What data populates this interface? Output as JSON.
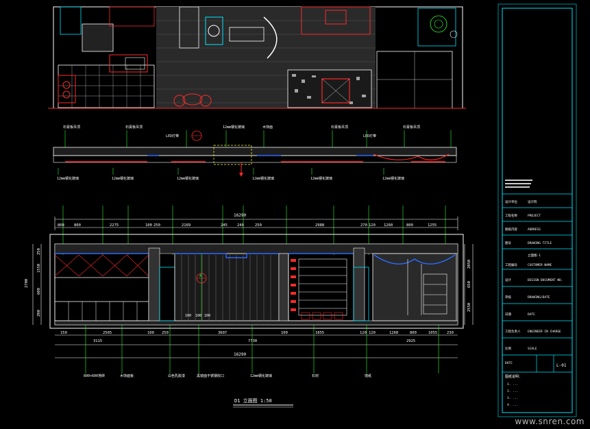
{
  "drawing": {
    "title_label": "D1  立面图  1:50",
    "watermark": "www.snren.com",
    "colors": {
      "background": "#000000",
      "line_white": "#ffffff",
      "line_cyan": "#00e5ff",
      "line_green": "#2bff2b",
      "line_red": "#ff2a2a",
      "line_blue": "#2a6bff",
      "line_yellow": "#ffff33",
      "line_magenta": "#ff33ff"
    },
    "section_labels": [
      "LED灯带",
      "12mm钢化玻璃",
      "木饰面",
      "石膏板吊顶",
      "LED灯带"
    ],
    "top_dimensions": [
      "808",
      "800",
      "2275",
      "100",
      "250",
      "2169",
      "245",
      "240",
      "250",
      "2988",
      "270",
      "120",
      "1260",
      "800",
      "1255"
    ],
    "total_top": "16290",
    "bottom_dimensions": [
      "150",
      "2565",
      "100",
      "250",
      "3607",
      "100",
      "1855",
      "120",
      "120",
      "1260",
      "800",
      "1055",
      "230"
    ],
    "bottom_totals": [
      "3115",
      "7730",
      "2925"
    ],
    "total_bottom": "16290",
    "height_dims_left": [
      "250",
      "1550",
      "600",
      "200"
    ],
    "height_dims_right": [
      "2050",
      "650",
      "2550"
    ],
    "height_total": "2700",
    "inner_dims": [
      "100",
      "100",
      "100"
    ],
    "bottom_notes": [
      "800×600地砖",
      "木饰面板",
      "白色乳胶漆",
      "黑镜面不锈钢收口",
      "12mm钢化玻璃",
      "石材",
      "墙纸"
    ],
    "center_mark": "A",
    "title_block": {
      "rows": [
        {
          "label": "设计单位",
          "value": "设计院"
        },
        {
          "label": "工程名称",
          "value": "PROJECT"
        },
        {
          "label": "图纸内容",
          "value": "ADDRESS"
        },
        {
          "label": "图号",
          "value": "DRAWING  TITLE"
        },
        {
          "label": "",
          "value": "立面图-1"
        },
        {
          "label": "工程编号",
          "value": "CUSTOMER NAME"
        },
        {
          "label": "设计",
          "value": "DESIGN DOCUMENT NO."
        },
        {
          "label": "审核",
          "value": "DRAWING/DATE"
        },
        {
          "label": "日期",
          "value": "DATE"
        },
        {
          "label": "工程负责人",
          "value": "ENGINEER IN CHARGE"
        },
        {
          "label": "比例",
          "value": "SCALE"
        }
      ],
      "sheet_number": "L-01",
      "date_label": "DATE",
      "notes_title": "图纸说明：",
      "notes": [
        "1. ...",
        "2. ...",
        "3. ...",
        "4. ..."
      ]
    }
  }
}
